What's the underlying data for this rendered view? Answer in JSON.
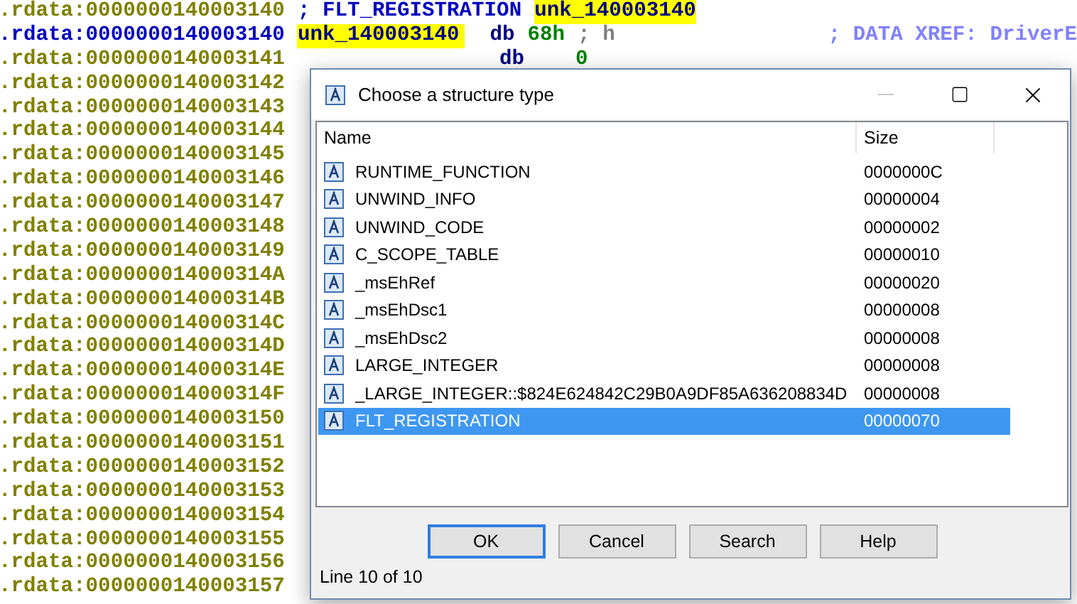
{
  "listing": {
    "lines": [
      {
        "kind": "comment",
        "selected": false,
        "address": ".rdata:0000000140003140",
        "comment": "; FLT_REGISTRATION",
        "label": "unk_140003140",
        "highlighted": true
      },
      {
        "kind": "data",
        "selected": true,
        "address": ".rdata:0000000140003140",
        "label": "unk_140003140",
        "highlighted": true,
        "mnemonic": "db",
        "operand": "68h",
        "operand_comment": "; h",
        "xref": "; DATA XREF: DriverE"
      },
      {
        "kind": "data",
        "selected": false,
        "address": ".rdata:0000000140003141",
        "mnemonic": "db",
        "operand": "0"
      },
      {
        "kind": "address",
        "selected": false,
        "address": ".rdata:0000000140003142"
      },
      {
        "kind": "address",
        "selected": false,
        "address": ".rdata:0000000140003143"
      },
      {
        "kind": "address",
        "selected": false,
        "address": ".rdata:0000000140003144"
      },
      {
        "kind": "address",
        "selected": false,
        "address": ".rdata:0000000140003145"
      },
      {
        "kind": "address",
        "selected": false,
        "address": ".rdata:0000000140003146"
      },
      {
        "kind": "address",
        "selected": false,
        "address": ".rdata:0000000140003147"
      },
      {
        "kind": "address",
        "selected": false,
        "address": ".rdata:0000000140003148"
      },
      {
        "kind": "address",
        "selected": false,
        "address": ".rdata:0000000140003149"
      },
      {
        "kind": "address",
        "selected": false,
        "address": ".rdata:000000014000314A"
      },
      {
        "kind": "address",
        "selected": false,
        "address": ".rdata:000000014000314B"
      },
      {
        "kind": "address",
        "selected": false,
        "address": ".rdata:000000014000314C"
      },
      {
        "kind": "address",
        "selected": false,
        "address": ".rdata:000000014000314D"
      },
      {
        "kind": "address",
        "selected": false,
        "address": ".rdata:000000014000314E"
      },
      {
        "kind": "address",
        "selected": false,
        "address": ".rdata:000000014000314F"
      },
      {
        "kind": "address",
        "selected": false,
        "address": ".rdata:0000000140003150"
      },
      {
        "kind": "address",
        "selected": false,
        "address": ".rdata:0000000140003151"
      },
      {
        "kind": "address",
        "selected": false,
        "address": ".rdata:0000000140003152"
      },
      {
        "kind": "address",
        "selected": false,
        "address": ".rdata:0000000140003153"
      },
      {
        "kind": "address",
        "selected": false,
        "address": ".rdata:0000000140003154"
      },
      {
        "kind": "address",
        "selected": false,
        "address": ".rdata:0000000140003155"
      },
      {
        "kind": "address",
        "selected": false,
        "address": ".rdata:0000000140003156"
      },
      {
        "kind": "address",
        "selected": false,
        "address": ".rdata:0000000140003157"
      }
    ]
  },
  "dialog": {
    "title": "Choose a structure type",
    "minimize_disabled": true,
    "columns": [
      "Name",
      "Size"
    ],
    "rows": [
      {
        "name": "RUNTIME_FUNCTION",
        "size": "0000000C",
        "selected": false
      },
      {
        "name": "UNWIND_INFO",
        "size": "00000004",
        "selected": false
      },
      {
        "name": "UNWIND_CODE",
        "size": "00000002",
        "selected": false
      },
      {
        "name": "C_SCOPE_TABLE",
        "size": "00000010",
        "selected": false
      },
      {
        "name": "_msEhRef",
        "size": "00000020",
        "selected": false
      },
      {
        "name": "_msEhDsc1",
        "size": "00000008",
        "selected": false
      },
      {
        "name": "_msEhDsc2",
        "size": "00000008",
        "selected": false
      },
      {
        "name": "LARGE_INTEGER",
        "size": "00000008",
        "selected": false
      },
      {
        "name": "_LARGE_INTEGER::$824E624842C29B0A9DF85A636208834D",
        "size": "00000008",
        "selected": false
      },
      {
        "name": "FLT_REGISTRATION",
        "size": "00000070",
        "selected": true
      }
    ],
    "buttons": [
      {
        "label": "OK",
        "default": true
      },
      {
        "label": "Cancel",
        "default": false
      },
      {
        "label": "Search",
        "default": false
      },
      {
        "label": "Help",
        "default": false
      }
    ],
    "status": "Line 10 of 10"
  }
}
